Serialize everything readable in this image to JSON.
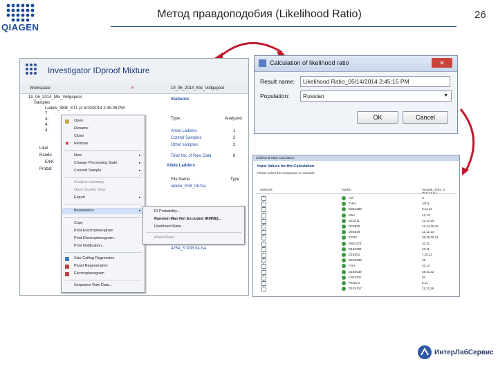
{
  "slide": {
    "title": "Метод правдоподобия (Likelihood Ratio)",
    "page_number": "26",
    "logo_text": "QIAGEN",
    "footer_brand": "ИнтерЛабСервис"
  },
  "investigator": {
    "app_title": "Investigator IDproof Mixture",
    "tab_workspace": "Workspace",
    "tab_right": "19_06_2014_Mix_Vollgepool",
    "tree": [
      "19_06_2014_Mix_Vollgepool",
      "Samples",
      "Luduw_SEB_ST1 (4 5/20/2014 2:45:06 PM",
      "7",
      "4:",
      "4:",
      "4:",
      "Likel",
      "Rando",
      "E4/K",
      "Probat"
    ],
    "statistics_header": "Statistics",
    "stats_col_type": "Type",
    "stats_col_analyzed": "Analyzed",
    "stats_rows": [
      {
        "type": "Allele Ladders",
        "value": "1"
      },
      {
        "type": "Control Samples",
        "value": "2"
      },
      {
        "type": "Other samples",
        "value": "2"
      },
      {
        "type": "Total No. of Raw Data",
        "value": "6"
      }
    ],
    "allele_ladders_header": "Allele Ladders",
    "file_name_col": "File Name",
    "type_col": "Type",
    "file_name_value": "ladder_E08_08.fsa",
    "bottom_item": "4254_S D08.04.fsa"
  },
  "context_menu": {
    "items": [
      {
        "label": "Open",
        "arrow": false
      },
      {
        "label": "Rename",
        "arrow": false
      },
      {
        "label": "Close",
        "arrow": false
      },
      {
        "label": "Remove",
        "arrow": false
      },
      {
        "label": "New",
        "arrow": true
      },
      {
        "label": "Change Processing State",
        "arrow": true
      },
      {
        "label": "Convert Sample",
        "arrow": true
      },
      {
        "label": "Analyze summary",
        "arrow": false
      },
      {
        "label": "Open Quality View",
        "arrow": false
      },
      {
        "label": "Export",
        "arrow": true
      },
      {
        "label": "Biostatistics",
        "arrow": true
      },
      {
        "label": "Copy",
        "arrow": false
      },
      {
        "label": "Print Electropherogram",
        "arrow": false
      },
      {
        "label": "Print Electropherogram...",
        "arrow": false
      },
      {
        "label": "Print Notification...",
        "arrow": false
      },
      {
        "label": "Size Calling Regression",
        "arrow": false
      },
      {
        "label": "Panel Regeneration",
        "arrow": false
      },
      {
        "label": "Electropherogram",
        "arrow": false
      },
      {
        "label": "Sequence Raw Data...",
        "arrow": false
      }
    ],
    "submenu": [
      "ID Probability...",
      "Random Man Not Excluded (RMNE)...",
      "Likelihood Ratio...",
      "Mixed Ratio"
    ]
  },
  "dialog": {
    "title": "Calculation of likelihood ratio",
    "result_name_label": "Result name:",
    "result_name_value": "Likelihood Ratio_05/14/2014 2:45:15 PM",
    "population_label": "Population:",
    "population_value": "Russian",
    "ok_label": "OK",
    "cancel_label": "Cancel"
  },
  "table_panel": {
    "window_title": "Likelihood Ratio Calculation",
    "header": "Input Values for the Calculation",
    "subheader": "Please select the comparison to calculate.",
    "col_select": "Selected",
    "col_marker": "Marker",
    "col_value": "Sample_4254_S D08.04.fsa",
    "rows": [
      {
        "marker": "AM",
        "value": "X"
      },
      {
        "marker": "TH01",
        "value": "10/11"
      },
      {
        "marker": "D3S1358",
        "value": "9,11,14"
      },
      {
        "marker": "vWA",
        "value": "12,13"
      },
      {
        "marker": "D21S11",
        "value": "12,14,16"
      },
      {
        "marker": "D7S820",
        "value": "13,14,15,16"
      },
      {
        "marker": "D5S818",
        "value": "11,12,13"
      },
      {
        "marker": "TPOX",
        "value": "28,29,30,31"
      },
      {
        "marker": "D8S1179",
        "value": "10,11"
      },
      {
        "marker": "D12S391",
        "value": "10,11"
      },
      {
        "marker": "D18S51",
        "value": "7,10,11"
      },
      {
        "marker": "D2S1338",
        "value": "15"
      },
      {
        "marker": "FGA",
        "value": "10,14"
      },
      {
        "marker": "D16S539",
        "value": "29,31,32"
      },
      {
        "marker": "CSF1PO",
        "value": "20"
      },
      {
        "marker": "Penta D",
        "value": "8,11"
      },
      {
        "marker": "D13S317",
        "value": "11,13,16"
      }
    ]
  },
  "colors": {
    "rule": "#2b4f8f",
    "arrow_red": "#c0182a",
    "brand_blue": "#2d58a8"
  }
}
